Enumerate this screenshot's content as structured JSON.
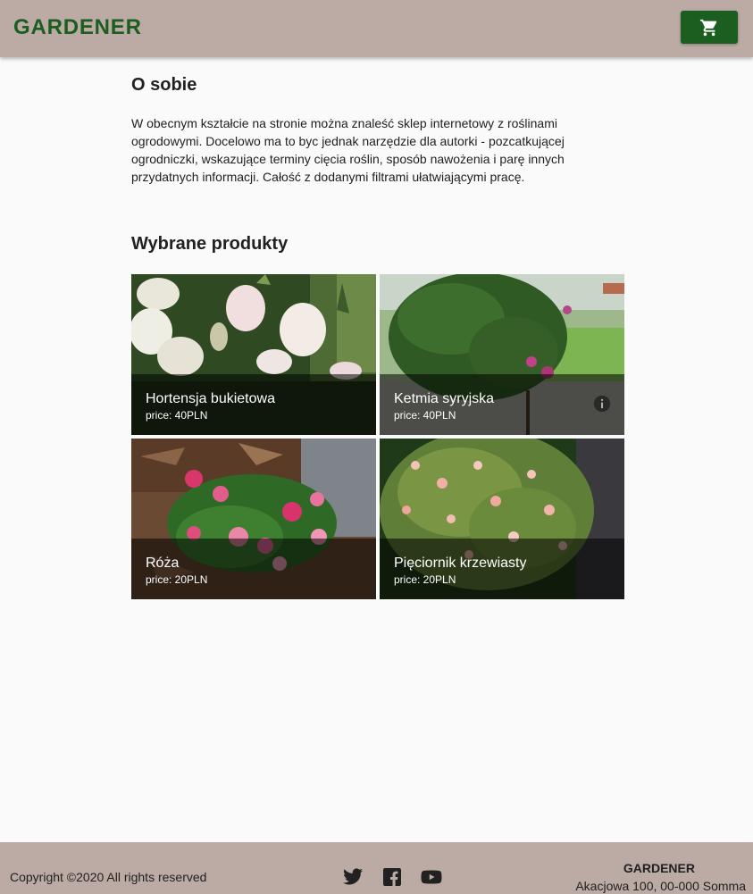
{
  "header": {
    "logo": "GARDENER",
    "cart_icon": "shopping-cart-icon"
  },
  "about": {
    "title": "O sobie",
    "text": "W obecnym kształcie na stronie można znaleść sklep internetowy z roślinami ogrodowymi. Docelowo ma to byc jednak narzędzie dla autorki - pozcatkującej ogrodniczki, wskazujące terminy cięcia roślin, sposób nawożenia i parę innych przydatnych informacji. Całość z dodanymi filtrami ułatwiającymi pracę."
  },
  "products": {
    "title": "Wybrane produkty",
    "items": [
      {
        "name": "Hortensja bukietowa",
        "price": "price: 40PLN"
      },
      {
        "name": "Ketmia syryjska",
        "price": "price: 40PLN",
        "info_icon": "info-icon"
      },
      {
        "name": "Róża",
        "price": "price: 20PLN"
      },
      {
        "name": "Pięciornik krzewiasty",
        "price": "price: 20PLN"
      }
    ]
  },
  "footer": {
    "copyright": "Copyright ©2020 All rights reserved",
    "social_icons": [
      "twitter-icon",
      "facebook-icon",
      "youtube-icon"
    ],
    "brand": "GARDENER",
    "address": "Akacjowa 100, 00-000 Somma"
  },
  "colors": {
    "header_bg": "#bcaaa4",
    "brand_green": "#1b5e20",
    "page_bg": "#fafafa"
  }
}
